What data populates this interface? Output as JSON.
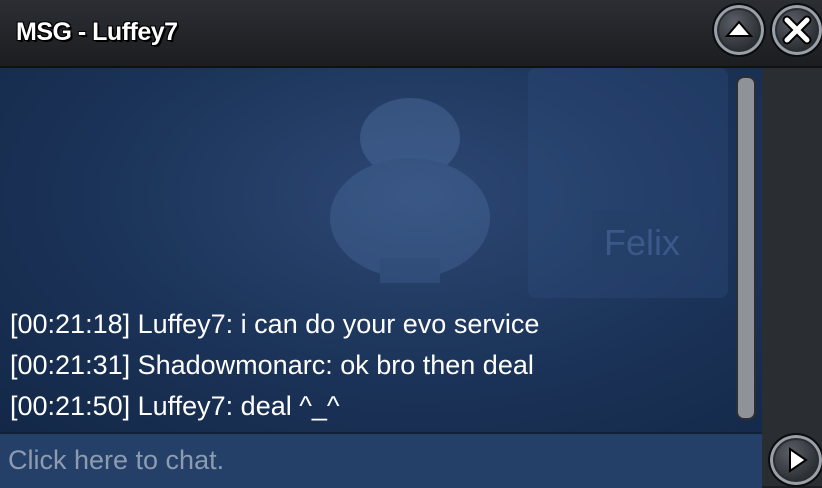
{
  "window": {
    "title": "MSG - Luffey7"
  },
  "chat": {
    "messages": [
      "[00:21:18] Luffey7: i can do your evo service",
      "[00:21:31] Shadowmonarc: ok bro then deal",
      "[00:21:50] Luffey7: deal ^_^"
    ],
    "background_text": "Felix"
  },
  "input": {
    "placeholder": "Click here to chat."
  },
  "icons": {
    "minimize": "up-arrow-icon",
    "close": "close-icon",
    "send": "play-arrow-icon"
  },
  "colors": {
    "chat_background": "#1b3358",
    "input_background": "#244068",
    "text": "#ffffff",
    "placeholder": "#8d9bb0"
  }
}
